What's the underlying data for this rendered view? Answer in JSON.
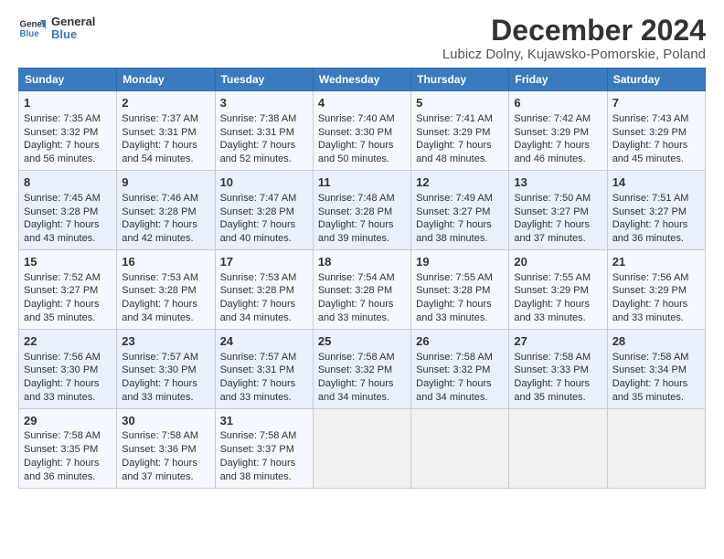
{
  "logo": {
    "text1": "General",
    "text2": "Blue"
  },
  "title": "December 2024",
  "subtitle": "Lubicz Dolny, Kujawsko-Pomorskie, Poland",
  "headers": [
    "Sunday",
    "Monday",
    "Tuesday",
    "Wednesday",
    "Thursday",
    "Friday",
    "Saturday"
  ],
  "weeks": [
    [
      {
        "day": "1",
        "rise": "Sunrise: 7:35 AM",
        "set": "Sunset: 3:32 PM",
        "daylight": "Daylight: 7 hours and 56 minutes."
      },
      {
        "day": "2",
        "rise": "Sunrise: 7:37 AM",
        "set": "Sunset: 3:31 PM",
        "daylight": "Daylight: 7 hours and 54 minutes."
      },
      {
        "day": "3",
        "rise": "Sunrise: 7:38 AM",
        "set": "Sunset: 3:31 PM",
        "daylight": "Daylight: 7 hours and 52 minutes."
      },
      {
        "day": "4",
        "rise": "Sunrise: 7:40 AM",
        "set": "Sunset: 3:30 PM",
        "daylight": "Daylight: 7 hours and 50 minutes."
      },
      {
        "day": "5",
        "rise": "Sunrise: 7:41 AM",
        "set": "Sunset: 3:29 PM",
        "daylight": "Daylight: 7 hours and 48 minutes."
      },
      {
        "day": "6",
        "rise": "Sunrise: 7:42 AM",
        "set": "Sunset: 3:29 PM",
        "daylight": "Daylight: 7 hours and 46 minutes."
      },
      {
        "day": "7",
        "rise": "Sunrise: 7:43 AM",
        "set": "Sunset: 3:29 PM",
        "daylight": "Daylight: 7 hours and 45 minutes."
      }
    ],
    [
      {
        "day": "8",
        "rise": "Sunrise: 7:45 AM",
        "set": "Sunset: 3:28 PM",
        "daylight": "Daylight: 7 hours and 43 minutes."
      },
      {
        "day": "9",
        "rise": "Sunrise: 7:46 AM",
        "set": "Sunset: 3:28 PM",
        "daylight": "Daylight: 7 hours and 42 minutes."
      },
      {
        "day": "10",
        "rise": "Sunrise: 7:47 AM",
        "set": "Sunset: 3:28 PM",
        "daylight": "Daylight: 7 hours and 40 minutes."
      },
      {
        "day": "11",
        "rise": "Sunrise: 7:48 AM",
        "set": "Sunset: 3:28 PM",
        "daylight": "Daylight: 7 hours and 39 minutes."
      },
      {
        "day": "12",
        "rise": "Sunrise: 7:49 AM",
        "set": "Sunset: 3:27 PM",
        "daylight": "Daylight: 7 hours and 38 minutes."
      },
      {
        "day": "13",
        "rise": "Sunrise: 7:50 AM",
        "set": "Sunset: 3:27 PM",
        "daylight": "Daylight: 7 hours and 37 minutes."
      },
      {
        "day": "14",
        "rise": "Sunrise: 7:51 AM",
        "set": "Sunset: 3:27 PM",
        "daylight": "Daylight: 7 hours and 36 minutes."
      }
    ],
    [
      {
        "day": "15",
        "rise": "Sunrise: 7:52 AM",
        "set": "Sunset: 3:27 PM",
        "daylight": "Daylight: 7 hours and 35 minutes."
      },
      {
        "day": "16",
        "rise": "Sunrise: 7:53 AM",
        "set": "Sunset: 3:28 PM",
        "daylight": "Daylight: 7 hours and 34 minutes."
      },
      {
        "day": "17",
        "rise": "Sunrise: 7:53 AM",
        "set": "Sunset: 3:28 PM",
        "daylight": "Daylight: 7 hours and 34 minutes."
      },
      {
        "day": "18",
        "rise": "Sunrise: 7:54 AM",
        "set": "Sunset: 3:28 PM",
        "daylight": "Daylight: 7 hours and 33 minutes."
      },
      {
        "day": "19",
        "rise": "Sunrise: 7:55 AM",
        "set": "Sunset: 3:28 PM",
        "daylight": "Daylight: 7 hours and 33 minutes."
      },
      {
        "day": "20",
        "rise": "Sunrise: 7:55 AM",
        "set": "Sunset: 3:29 PM",
        "daylight": "Daylight: 7 hours and 33 minutes."
      },
      {
        "day": "21",
        "rise": "Sunrise: 7:56 AM",
        "set": "Sunset: 3:29 PM",
        "daylight": "Daylight: 7 hours and 33 minutes."
      }
    ],
    [
      {
        "day": "22",
        "rise": "Sunrise: 7:56 AM",
        "set": "Sunset: 3:30 PM",
        "daylight": "Daylight: 7 hours and 33 minutes."
      },
      {
        "day": "23",
        "rise": "Sunrise: 7:57 AM",
        "set": "Sunset: 3:30 PM",
        "daylight": "Daylight: 7 hours and 33 minutes."
      },
      {
        "day": "24",
        "rise": "Sunrise: 7:57 AM",
        "set": "Sunset: 3:31 PM",
        "daylight": "Daylight: 7 hours and 33 minutes."
      },
      {
        "day": "25",
        "rise": "Sunrise: 7:58 AM",
        "set": "Sunset: 3:32 PM",
        "daylight": "Daylight: 7 hours and 34 minutes."
      },
      {
        "day": "26",
        "rise": "Sunrise: 7:58 AM",
        "set": "Sunset: 3:32 PM",
        "daylight": "Daylight: 7 hours and 34 minutes."
      },
      {
        "day": "27",
        "rise": "Sunrise: 7:58 AM",
        "set": "Sunset: 3:33 PM",
        "daylight": "Daylight: 7 hours and 35 minutes."
      },
      {
        "day": "28",
        "rise": "Sunrise: 7:58 AM",
        "set": "Sunset: 3:34 PM",
        "daylight": "Daylight: 7 hours and 35 minutes."
      }
    ],
    [
      {
        "day": "29",
        "rise": "Sunrise: 7:58 AM",
        "set": "Sunset: 3:35 PM",
        "daylight": "Daylight: 7 hours and 36 minutes."
      },
      {
        "day": "30",
        "rise": "Sunrise: 7:58 AM",
        "set": "Sunset: 3:36 PM",
        "daylight": "Daylight: 7 hours and 37 minutes."
      },
      {
        "day": "31",
        "rise": "Sunrise: 7:58 AM",
        "set": "Sunset: 3:37 PM",
        "daylight": "Daylight: 7 hours and 38 minutes."
      },
      null,
      null,
      null,
      null
    ]
  ]
}
